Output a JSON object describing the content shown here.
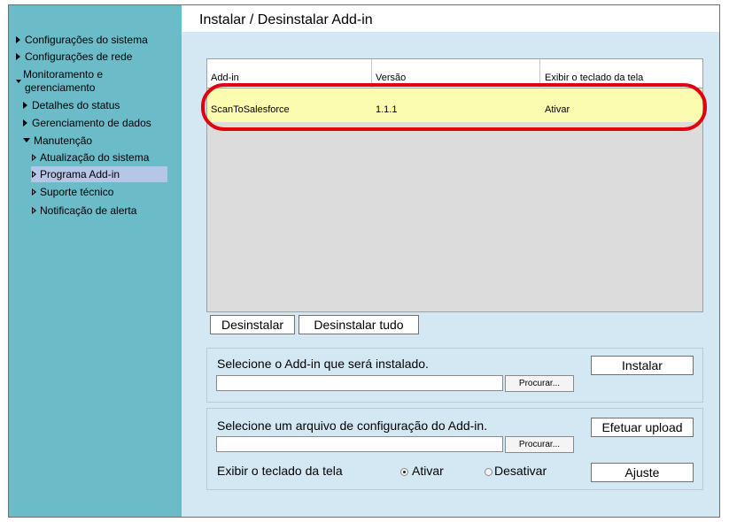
{
  "page_title": "Instalar / Desinstalar Add-in",
  "sidebar": {
    "items": [
      {
        "label": "Configurações do sistema",
        "marker": "triangle-right"
      },
      {
        "label": "Configurações de rede",
        "marker": "triangle-right"
      },
      {
        "label": "Monitoramento e",
        "label2": "gerenciamento",
        "marker": "triangle-down-small"
      },
      {
        "label": "Detalhes do status",
        "marker": "triangle-right"
      },
      {
        "label": "Gerenciamento de dados",
        "marker": "triangle-right"
      },
      {
        "label": "Manutenção",
        "marker": "triangle-down"
      },
      {
        "label": "Atualização do sistema",
        "marker": "triangle-outline"
      },
      {
        "label": "Programa Add-in",
        "marker": "triangle-outline",
        "selected": true
      },
      {
        "label": "Suporte técnico",
        "marker": "triangle-outline"
      },
      {
        "label": "Notificação de alerta",
        "marker": "triangle-outline"
      }
    ]
  },
  "table": {
    "columns": [
      "Add-in",
      "Versão",
      "Exibir o teclado da tela"
    ],
    "rows": [
      {
        "addin": "ScanToSalesforce",
        "version": "1.1.1",
        "keyboard": "Ativar"
      }
    ]
  },
  "buttons": {
    "uninstall": "Desinstalar",
    "uninstall_all": "Desinstalar tudo",
    "install": "Instalar",
    "upload": "Efetuar upload",
    "adjust": "Ajuste",
    "browse": "Procurar..."
  },
  "install_panel": {
    "prompt": "Selecione o Add-in que será instalado.",
    "file_value": ""
  },
  "config_panel": {
    "prompt": "Selecione um arquivo de configuração do Add-in.",
    "file_value": "",
    "keyboard_label": "Exibir o teclado da tela",
    "option_on": "Ativar",
    "option_off": "Desativar",
    "selected": "Ativar"
  },
  "colors": {
    "sidebar_bg": "#6bbbc9",
    "main_bg": "#d4e8f4",
    "selected_row": "#fcfcb0",
    "highlight": "#e00010",
    "nav_selected": "#b6c6e6"
  }
}
